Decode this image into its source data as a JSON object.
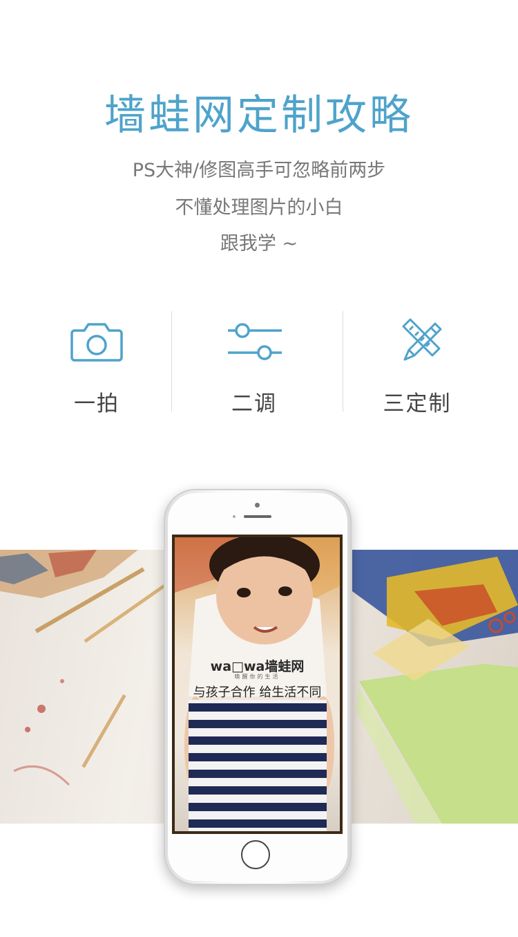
{
  "header": {
    "title": "墙蛙网定制攻略",
    "lines": [
      "PS大神/修图高手可忽略前两步",
      "不懂处理图片的小白",
      "跟我学 ~"
    ]
  },
  "steps": [
    {
      "label": "一拍",
      "icon": "camera-icon"
    },
    {
      "label": "二调",
      "icon": "sliders-icon"
    },
    {
      "label": "三定制",
      "icon": "pencil-ruler-icon"
    }
  ],
  "phone": {
    "logo": "wa□wa墙蛙网",
    "logo_sub": "唤醒你的生活",
    "slogan": "与孩子合作 给生活不同"
  },
  "colors": {
    "accent": "#4ea3cb",
    "text": "#777777"
  }
}
